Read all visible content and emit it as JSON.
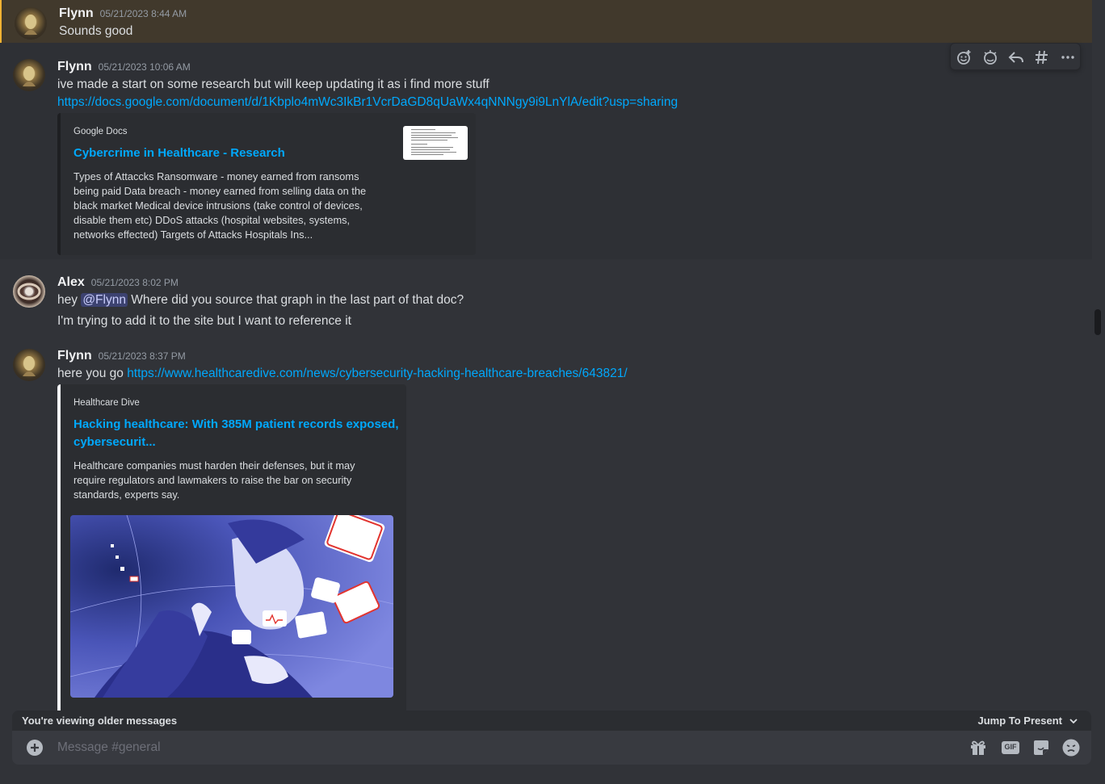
{
  "messages": [
    {
      "author": "Flynn",
      "timestamp": "05/21/2023 8:44 AM",
      "lines": [
        "Sounds good"
      ]
    },
    {
      "author": "Flynn",
      "timestamp": "05/21/2023 10:06 AM",
      "lines": [
        "ive made a start on some research but will keep updating it as i find more stuff"
      ],
      "link": "https://docs.google.com/document/d/1Kbplo4mWc3IkBr1VcrDaGD8qUaWx4qNNNgy9i9LnYlA/edit?usp=sharing",
      "embed": {
        "provider": "Google Docs",
        "title": "Cybercrime in Healthcare - Research",
        "description": [
          "Types of Attaccks Ransomware - money earned from ransoms",
          "being paid Data breach - money earned from selling data on the",
          "black market Medical device intrusions (take control of devices,",
          "disable them etc) DDoS attacks (hospital websites, systems,",
          "networks effected) Targets of Attacks Hospitals Ins..."
        ]
      }
    },
    {
      "author": "Alex",
      "timestamp": "05/21/2023 8:02 PM",
      "line1_before": "hey ",
      "mention": "@Flynn",
      "line1_after": " Where did you source that graph in the last part of that doc?",
      "line2": "I'm trying to add it to the site but I want to reference it"
    },
    {
      "author": "Flynn",
      "timestamp": "05/21/2023 8:37 PM",
      "text_before": "here you go ",
      "link": "https://www.healthcaredive.com/news/cybersecurity-hacking-healthcare-breaches/643821/",
      "embed": {
        "provider": "Healthcare Dive",
        "title_line1": "Hacking healthcare: With 385M patient records exposed,",
        "title_line2": "cybersecurit...",
        "description": [
          "Healthcare companies must harden their defenses, but it may",
          "require regulators and lawmakers to raise the bar on security",
          "standards, experts say."
        ]
      }
    }
  ],
  "toolbar": {
    "icons": [
      "add-reaction-icon",
      "super-reaction-icon",
      "reply-icon",
      "create-thread-icon",
      "more-icon"
    ]
  },
  "older_banner": {
    "text": "You're viewing older messages",
    "jump_label": "Jump To Present"
  },
  "composer": {
    "placeholder": "Message #general",
    "icons": [
      "add-attachment-icon",
      "gift-icon",
      "gif-icon",
      "sticker-icon",
      "emoji-icon"
    ],
    "gif_label": "GIF"
  },
  "colors": {
    "background": "#313338",
    "link": "#00a8fc",
    "highlight": "#41392c",
    "highlight_bar": "#f0b232",
    "mention_bg": "#3c4270",
    "embed_bg": "#2b2d31"
  }
}
